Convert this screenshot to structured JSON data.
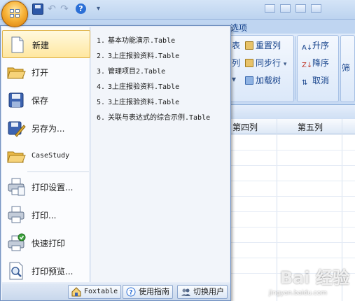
{
  "ribbon": {
    "tab_label": "选项",
    "group1": [
      {
        "label": "表",
        "icon": "table-icon"
      },
      {
        "label": "列",
        "icon": "column-icon"
      }
    ],
    "group2": [
      {
        "label": "重置列",
        "icon": "reset-columns-icon"
      },
      {
        "label": "同步行",
        "icon": "sync-rows-icon"
      },
      {
        "label": "加载树",
        "icon": "load-tree-icon"
      }
    ],
    "group3": [
      {
        "label": "升序",
        "icon": "sort-ascending-icon"
      },
      {
        "label": "降序",
        "icon": "sort-descending-icon"
      },
      {
        "label": "取消",
        "icon": "cancel-sort-icon"
      }
    ],
    "filter_label": "筛"
  },
  "grid": {
    "columns": [
      "第四列",
      "第五列"
    ]
  },
  "menu": {
    "items": [
      {
        "label": "新建",
        "icon": "new-document-icon"
      },
      {
        "label": "打开",
        "icon": "open-folder-icon"
      },
      {
        "label": "保存",
        "icon": "save-disk-icon"
      },
      {
        "label": "另存为...",
        "icon": "save-as-icon"
      },
      {
        "label": "CaseStudy",
        "icon": "folder-icon"
      },
      {
        "label": "打印设置...",
        "icon": "print-setup-icon"
      },
      {
        "label": "打印...",
        "icon": "printer-icon"
      },
      {
        "label": "快速打印",
        "icon": "quick-print-icon"
      },
      {
        "label": "打印预览...",
        "icon": "print-preview-icon"
      }
    ],
    "recent": [
      {
        "num": "1.",
        "name": "基本功能演示.Table"
      },
      {
        "num": "2.",
        "name": "3上庄报验资料.Table"
      },
      {
        "num": "3.",
        "name": "管理项目2.Table"
      },
      {
        "num": "4.",
        "name": "3上庄报验资料.Table"
      },
      {
        "num": "5.",
        "name": "3上庄报验资料.Table"
      },
      {
        "num": "6.",
        "name": "关联与表达式的综合示例.Table"
      }
    ],
    "bottom": {
      "foxtable": "Foxtable",
      "guide": "使用指南",
      "switch_user": "切换用户"
    }
  },
  "watermark": {
    "text": "Bai 经验",
    "url": "jingyan.baidu.com"
  },
  "colors": {
    "ribbon_text": "#15428b",
    "hover_border": "#e0b44c",
    "orb": "#f7b43a"
  }
}
